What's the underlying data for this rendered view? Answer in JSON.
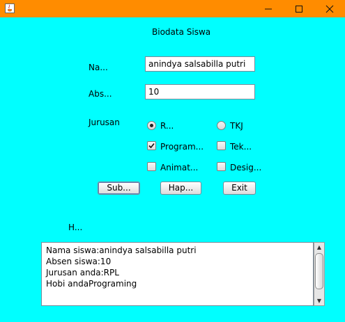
{
  "window": {
    "title": ""
  },
  "form": {
    "heading": "Biodata Siswa",
    "nama_label": "Na...",
    "nama_value": "anindya salsabilla putri",
    "absen_label": "Abs...",
    "absen_value": "10",
    "jurusan_label": "Jurusan",
    "radio_rpl": {
      "label": "R...",
      "selected": true
    },
    "radio_tkj": {
      "label": "TKJ",
      "selected": false
    },
    "hobi": [
      {
        "label": "Program...",
        "checked": true
      },
      {
        "label": "Tek...",
        "checked": false
      },
      {
        "label": "Animat...",
        "checked": false
      },
      {
        "label": "Desig...",
        "checked": false
      }
    ],
    "buttons": {
      "submit": "Sub...",
      "hapus": "Hap...",
      "exit": "Exit"
    },
    "hasil_label": "H...",
    "output_lines": [
      "Nama siswa:anindya salsabilla putri",
      "Absen siswa:10",
      "Jurusan anda:RPL",
      "Hobi andaPrograming"
    ]
  },
  "colors": {
    "titlebar": "#ff8c00",
    "background": "#00ffff"
  },
  "icons": [
    "java-app-icon",
    "minimize-icon",
    "maximize-icon",
    "close-icon",
    "scroll-up-icon",
    "scroll-down-icon"
  ]
}
